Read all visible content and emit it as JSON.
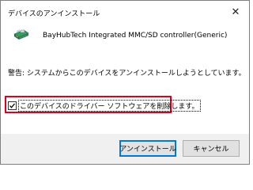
{
  "window": {
    "title": "デバイスのアンインストール",
    "close_label": "✕"
  },
  "device": {
    "name": "BayHubTech Integrated MMC/SD controller(Generic)",
    "icon": "card-reader-icon"
  },
  "warning_text": "警告: システムからこのデバイスをアンインストールしようとしています。",
  "delete_driver": {
    "label": "このデバイスのドライバー ソフトウェアを削除します。",
    "checked": true
  },
  "buttons": {
    "uninstall_label": "アンインストール",
    "cancel_label": "キャンセル"
  },
  "colors": {
    "highlight_border": "#e0001b",
    "primary_border": "#0078d7"
  }
}
